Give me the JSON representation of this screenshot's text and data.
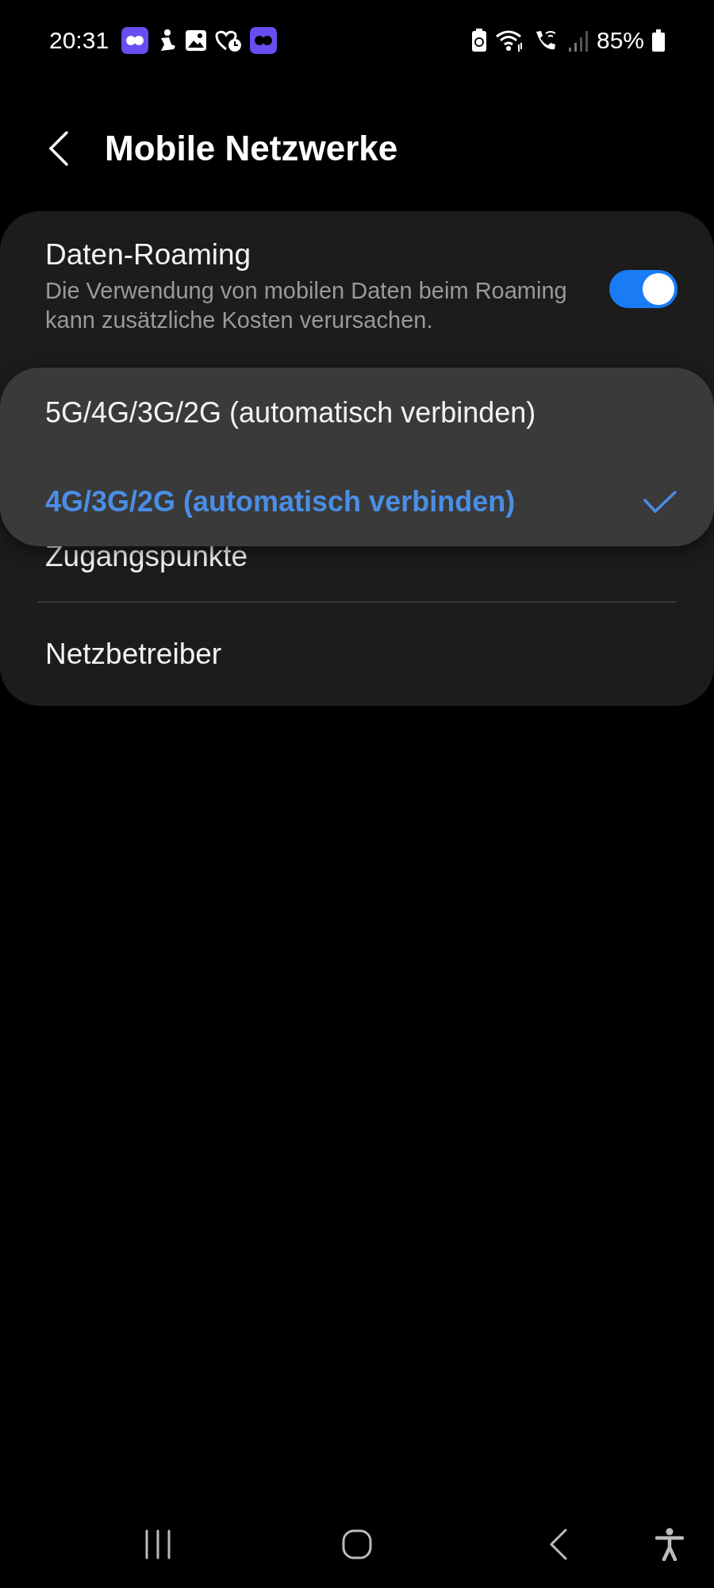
{
  "status_bar": {
    "time": "20:31",
    "battery": "85%"
  },
  "header": {
    "title": "Mobile Netzwerke"
  },
  "settings": [
    {
      "kind": "toggle",
      "title": "Daten-Roaming",
      "subtitle": "Die Verwendung von mobilen Daten beim Roaming kann zusätzliche Kosten verursachen.",
      "on": true
    },
    {
      "kind": "link",
      "title": "Zugangspunkte"
    },
    {
      "kind": "link",
      "title": "Netzbetreiber"
    }
  ],
  "popup": {
    "options": [
      {
        "label": "5G/4G/3G/2G (automatisch verbinden)",
        "selected": false
      },
      {
        "label": "4G/3G/2G (automatisch verbinden)",
        "selected": true
      }
    ]
  }
}
